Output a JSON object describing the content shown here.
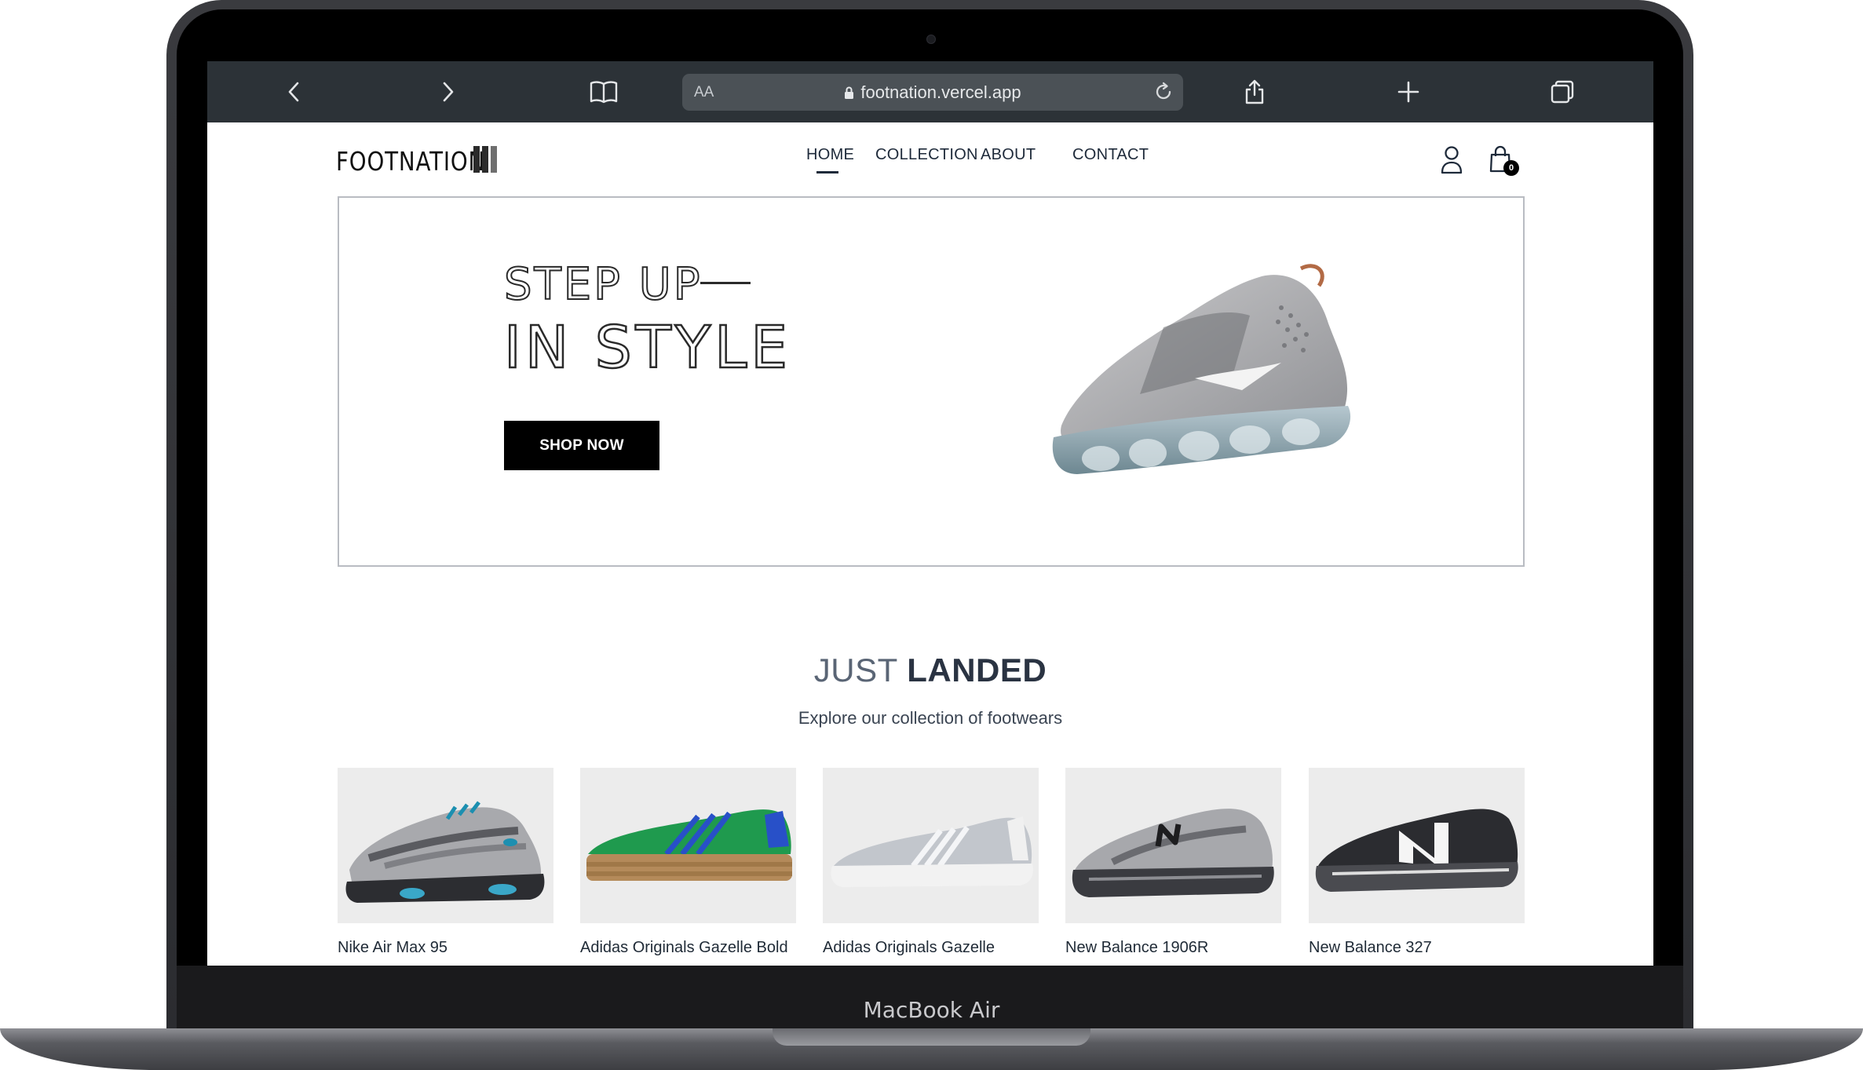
{
  "browser": {
    "address_aa": "AA",
    "url": "footnation.vercel.app"
  },
  "site": {
    "logo_text": "FOOTNATION",
    "nav": [
      {
        "label": "HOME",
        "active": true
      },
      {
        "label": "COLLECTION"
      },
      {
        "label": "ABOUT"
      },
      {
        "label": "CONTACT"
      }
    ],
    "cart_count": "0"
  },
  "hero": {
    "line1": "STEP UP",
    "line2": "IN STYLE",
    "button": "SHOP NOW"
  },
  "section": {
    "title_light": "JUST",
    "title_bold": "LANDED",
    "subtitle": "Explore our collection of footwears"
  },
  "products": [
    {
      "name": "Nike Air Max 95",
      "image": "grey-teal-sneaker"
    },
    {
      "name": "Adidas Originals Gazelle Bold",
      "image": "green-blue-sneaker"
    },
    {
      "name": "Adidas Originals Gazelle",
      "image": "light-grey-sneaker"
    },
    {
      "name": "New Balance 1906R",
      "image": "silver-running-sneaker"
    },
    {
      "name": "New Balance 327",
      "image": "black-white-sneaker"
    }
  ],
  "device": {
    "model": "MacBook Air"
  },
  "colors": {
    "toolbar": "#2c3237",
    "urlbar": "#4b5156",
    "nav_text": "#1e2a3a",
    "button_bg": "#000000",
    "card_bg": "#ececec"
  }
}
